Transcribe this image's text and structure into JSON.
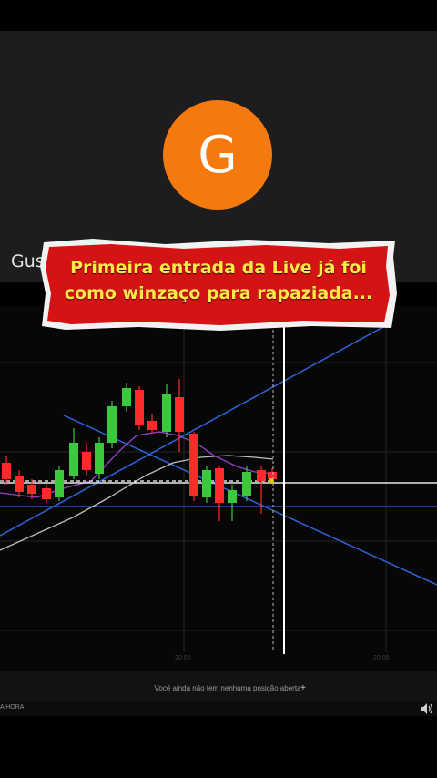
{
  "call": {
    "avatar_letter": "G",
    "avatar_color": "#f47a10",
    "participant_name": "Gus"
  },
  "banner": {
    "line1": "Primeira entrada da Live já foi",
    "line2": "como winzaço para rapaziada...",
    "text_color": "#ffe94a",
    "background_color": "#d41414"
  },
  "chart": {
    "bullish_color": "#3cc83c",
    "bearish_color": "#ff2a2a",
    "bottom_labels": [
      "20:00",
      "20:05"
    ]
  },
  "status_bar": {
    "message": "Você ainda não tem nenhuma posição aberta",
    "plus": "+"
  },
  "bottom_bar": {
    "time_label": "A HORA"
  }
}
